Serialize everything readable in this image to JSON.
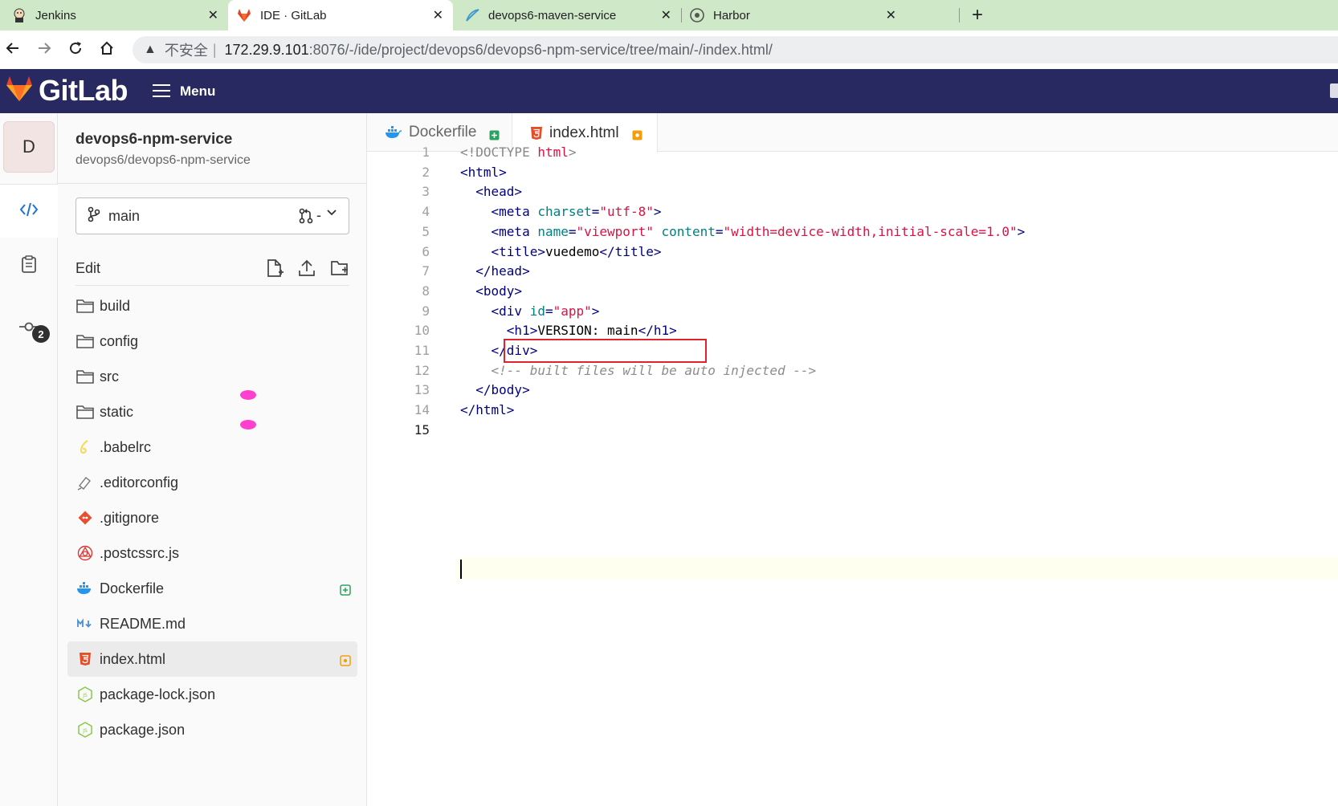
{
  "browser": {
    "tabs": [
      {
        "title": "Jenkins",
        "icon": "jenkins-icon"
      },
      {
        "title": "IDE · GitLab",
        "icon": "gitlab-icon",
        "active": true
      },
      {
        "title": "devops6-maven-service",
        "icon": "feather-icon"
      },
      {
        "title": "Harbor",
        "icon": "harbor-icon"
      }
    ],
    "close_glyph": "✕",
    "new_tab_glyph": "+",
    "address": {
      "warning_glyph": "▲",
      "insecure_label": "不安全",
      "separator": "|",
      "host": "172.29.9.101",
      "path": ":8076/-/ide/project/devops6/devops6-npm-service/tree/main/-/index.html/"
    }
  },
  "gitlab": {
    "logo_text": "GitLab",
    "menu_label": "Menu",
    "brand_color": "#292961"
  },
  "project": {
    "avatar_letter": "D",
    "name": "devops6-npm-service",
    "path": "devops6/devops6-npm-service"
  },
  "rail": {
    "commit_badge": "2"
  },
  "branch": {
    "name": "main",
    "mr_value": "-"
  },
  "sidebar": {
    "edit_label": "Edit",
    "files": [
      {
        "name": "build",
        "type": "folder"
      },
      {
        "name": "config",
        "type": "folder"
      },
      {
        "name": "src",
        "type": "folder"
      },
      {
        "name": "static",
        "type": "folder"
      },
      {
        "name": ".babelrc",
        "type": "babel"
      },
      {
        "name": ".editorconfig",
        "type": "editorconfig"
      },
      {
        "name": ".gitignore",
        "type": "git"
      },
      {
        "name": ".postcssrc.js",
        "type": "postcss"
      },
      {
        "name": "Dockerfile",
        "type": "docker",
        "status": "added"
      },
      {
        "name": "README.md",
        "type": "markdown"
      },
      {
        "name": "index.html",
        "type": "html",
        "status": "modified",
        "active": true
      },
      {
        "name": "package-lock.json",
        "type": "node"
      },
      {
        "name": "package.json",
        "type": "node"
      }
    ]
  },
  "editor": {
    "tabs": [
      {
        "name": "Dockerfile",
        "status": "added"
      },
      {
        "name": "index.html",
        "status": "modified",
        "active": true
      }
    ],
    "current_line": 15,
    "highlighted_line": 10,
    "lines": [
      [
        [
          "t-doc",
          "<!DOCTYPE "
        ],
        [
          "t-str",
          "html"
        ],
        [
          "t-doc",
          ">"
        ]
      ],
      [
        [
          "t-tag",
          "<html>"
        ]
      ],
      [
        [
          "t-txt",
          "  "
        ],
        [
          "t-tag",
          "<head>"
        ]
      ],
      [
        [
          "t-txt",
          "    "
        ],
        [
          "t-tag",
          "<meta "
        ],
        [
          "t-attr",
          "charset"
        ],
        [
          "t-tag",
          "="
        ],
        [
          "t-str",
          "\"utf-8\""
        ],
        [
          "t-tag",
          ">"
        ]
      ],
      [
        [
          "t-txt",
          "    "
        ],
        [
          "t-tag",
          "<meta "
        ],
        [
          "t-attr",
          "name"
        ],
        [
          "t-tag",
          "="
        ],
        [
          "t-str",
          "\"viewport\""
        ],
        [
          "t-txt",
          " "
        ],
        [
          "t-attr",
          "content"
        ],
        [
          "t-tag",
          "="
        ],
        [
          "t-str",
          "\"width=device-width,initial-scale=1.0\""
        ],
        [
          "t-tag",
          ">"
        ]
      ],
      [
        [
          "t-txt",
          "    "
        ],
        [
          "t-tag",
          "<title>"
        ],
        [
          "t-txt",
          "vuedemo"
        ],
        [
          "t-tag",
          "</title>"
        ]
      ],
      [
        [
          "t-txt",
          "  "
        ],
        [
          "t-tag",
          "</head>"
        ]
      ],
      [
        [
          "t-txt",
          "  "
        ],
        [
          "t-tag",
          "<body>"
        ]
      ],
      [
        [
          "t-txt",
          "    "
        ],
        [
          "t-tag",
          "<div "
        ],
        [
          "t-attr",
          "id"
        ],
        [
          "t-tag",
          "="
        ],
        [
          "t-str",
          "\"app\""
        ],
        [
          "t-tag",
          ">"
        ]
      ],
      [
        [
          "t-txt",
          "      "
        ],
        [
          "t-tag",
          "<h1>"
        ],
        [
          "t-txt",
          "VERSION: main"
        ],
        [
          "t-tag",
          "</h1>"
        ]
      ],
      [
        [
          "t-txt",
          "    "
        ],
        [
          "t-tag",
          "</div>"
        ]
      ],
      [
        [
          "t-txt",
          "    "
        ],
        [
          "t-com",
          "<!-- built files will be auto injected -->"
        ]
      ],
      [
        [
          "t-txt",
          "  "
        ],
        [
          "t-tag",
          "</body>"
        ]
      ],
      [
        [
          "t-tag",
          "</html>"
        ]
      ],
      [
        [
          "t-txt",
          ""
        ]
      ]
    ]
  }
}
